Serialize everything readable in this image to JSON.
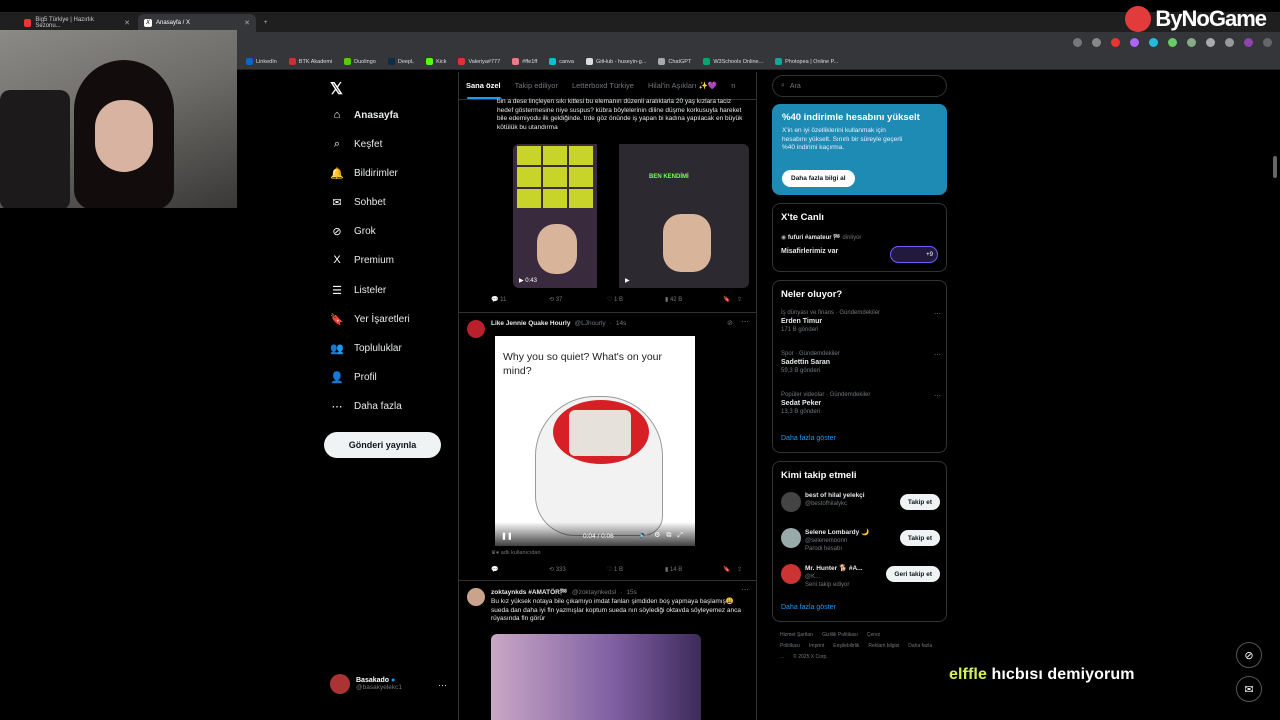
{
  "brand": {
    "name": "ByNoGame"
  },
  "browser": {
    "tabs": [
      {
        "label": "Big5 Türkiye | Hazırlık Sezonu..."
      },
      {
        "label": "Anasayfa / X"
      }
    ],
    "bookmarks": [
      {
        "label": "LinkedIn",
        "color": "#0a66c2"
      },
      {
        "label": "BTK Akademi",
        "color": "#c93232"
      },
      {
        "label": "Duolingo",
        "color": "#58cc02"
      },
      {
        "label": "DeepL",
        "color": "#0f2b46"
      },
      {
        "label": "Kick",
        "color": "#53fc18"
      },
      {
        "label": "Valeriya#777",
        "color": "#d33"
      },
      {
        "label": "#ffe1ff",
        "color": "#e78"
      },
      {
        "label": "canva",
        "color": "#00c4cc"
      },
      {
        "label": "GitHub - huseyin-g...",
        "color": "#ddd"
      },
      {
        "label": "ChatGPT",
        "color": "#aaa"
      },
      {
        "label": "W3Schools Online...",
        "color": "#04aa6d"
      },
      {
        "label": "Photopea | Online P...",
        "color": "#18a497"
      }
    ]
  },
  "nav": {
    "items": [
      {
        "label": "Anasayfa",
        "icon": "home-icon",
        "glyph": "⌂"
      },
      {
        "label": "Keşfet",
        "icon": "search-icon",
        "glyph": "⌕"
      },
      {
        "label": "Bildirimler",
        "icon": "bell-icon",
        "glyph": "🔔"
      },
      {
        "label": "Sohbet",
        "icon": "mail-icon",
        "glyph": "✉"
      },
      {
        "label": "Grok",
        "icon": "grok-icon",
        "glyph": "⊘"
      },
      {
        "label": "Premium",
        "icon": "x-icon",
        "glyph": "X"
      },
      {
        "label": "Listeler",
        "icon": "list-icon",
        "glyph": "☰"
      },
      {
        "label": "Yer İşaretleri",
        "icon": "bookmark-icon",
        "glyph": "🔖"
      },
      {
        "label": "Topluluklar",
        "icon": "people-icon",
        "glyph": "👥"
      },
      {
        "label": "Profil",
        "icon": "person-icon",
        "glyph": "👤"
      },
      {
        "label": "Daha fazla",
        "icon": "more-icon",
        "glyph": "⋯"
      }
    ],
    "post_button": "Gönderi yayınla",
    "account": {
      "name": "Basakado",
      "handle": "@basakyelekc1"
    }
  },
  "timeline": {
    "tabs": [
      "Sana özel",
      "Takip ediliyor",
      "Letterboxd Türkiye",
      "Hilal'in Aşıkları ✨💜",
      "n"
    ],
    "tweet1": {
      "text": "bin a dese linçleyen sıkı kitlesi bu elemanın düzenli aralıklarla 20 yaş kızlara taciz hedef göstermesine niye suspus? kübra böylelerinin diline düşme korkusuyla hareket bile edemiyodu ilk geldiğinde. trde göz önünde iş yapan bi kadına yapılacak en büyük kötülük bu utandırma",
      "video_time": "0:43",
      "overlay": "BEN KENDİMİ",
      "replies": "11",
      "reposts": "37",
      "likes": "1 B",
      "views": "42 B"
    },
    "tweet2": {
      "name": "Like Jennie Quake Hourly",
      "handle": "@LJhourly",
      "time": "14s",
      "meme_text": "Why you so quiet? What's on your mind?",
      "video_time": "0:04 / 0:06",
      "by_user": "adlı kullanıcıdan",
      "reposts": "333",
      "likes": "1 B",
      "views": "14 B"
    },
    "tweet3": {
      "name": "zoktaynkds #AMATÖR🏁",
      "handle": "@zoktaynkedsl",
      "time": "15s",
      "text": "Bu kız yüksek notaya bile çıkamıyo imdat fanları şimdiden boş yapmaya başlamış😩 sueda dan daha iyi fln yazmışlar koptum sueda nın söylediği oktavda söyleyemez anca rüyasında fln görür"
    }
  },
  "sidebar": {
    "search_placeholder": "Ara",
    "premium": {
      "title": "%40 indirimle hesabını yükselt",
      "text": "X'in en iyi özelliklerini kullanmak için hesabını yükselt. Sınırlı bir süreyle geçerli %40 indirimi kaçırma.",
      "button": "Daha fazla bilgi al"
    },
    "live": {
      "title": "X'te Canlı",
      "host": "fufuri #amateur 🏁",
      "status": "dinliyor",
      "desc": "Misafirlerimiz var",
      "count": "+9"
    },
    "trends": {
      "title": "Neler oluyor?",
      "items": [
        {
          "meta": "İş dünyası ve finans · Gündemdekiler",
          "name": "Erden Timur",
          "posts": "171 B gönderi"
        },
        {
          "meta": "Spor · Gündemdekiler",
          "name": "Sadettin Saran",
          "posts": "59,3 B gönderi"
        },
        {
          "meta": "Popüler videolar · Gündemdekiler",
          "name": "Sedat Peker",
          "posts": "13,3 B gönderi"
        }
      ],
      "more": "Daha fazla göster"
    },
    "follow": {
      "title": "Kimi takip etmeli",
      "items": [
        {
          "name": "best of hilal yelekçi",
          "handle": "@bestofhilalykc",
          "sub": "",
          "button": "Takip et"
        },
        {
          "name": "Selene Lombardy 🌙",
          "handle": "@selenemoonn",
          "sub": "Parodi hesabı",
          "button": "Takip et"
        },
        {
          "name": "Mr. Hunter 🐕 #A...",
          "handle": "@K...",
          "sub": "Seni takip ediyor",
          "button": "Geri takip et"
        }
      ],
      "more": "Daha fazla göster"
    },
    "footer": [
      "Hizmet Şartları",
      "Gizlilik Politikası",
      "Çerez Politikası",
      "Imprint",
      "Erişilebilirlik",
      "Reklam bilgisi",
      "Daha fazla ...",
      "© 2025 X Corp."
    ]
  },
  "subtitle": {
    "highlight": "elffle",
    "text": "hıcbısı demiyorum"
  }
}
